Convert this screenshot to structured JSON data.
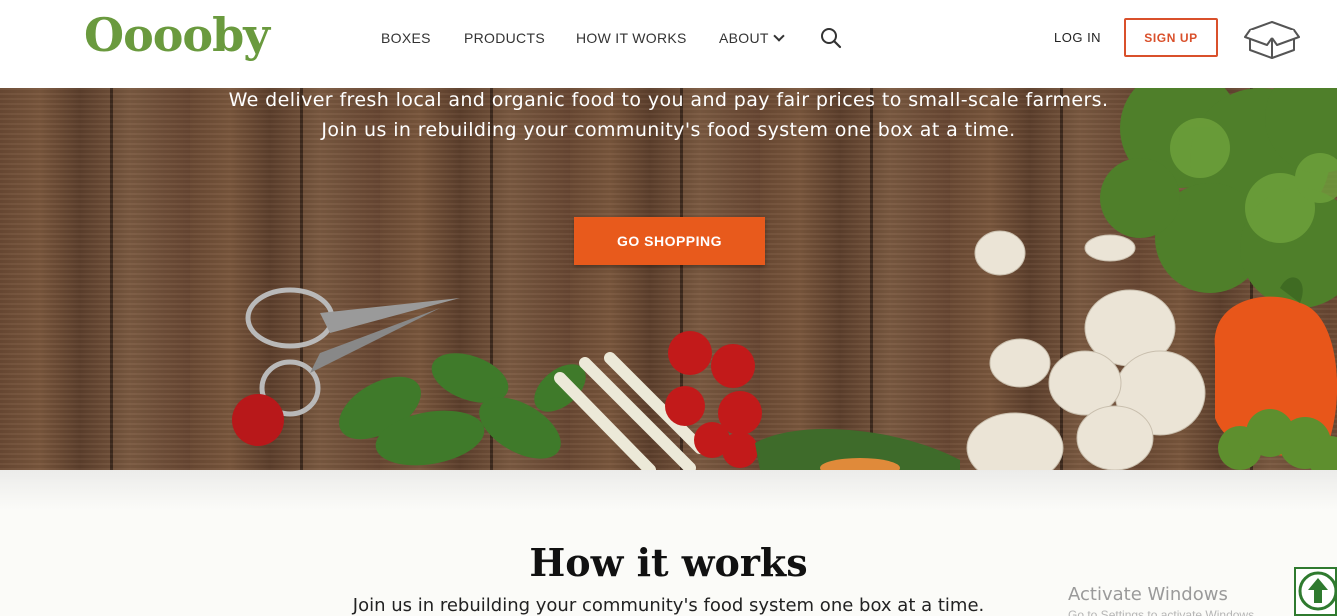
{
  "header": {
    "logo": "Ooooby",
    "nav": [
      "BOXES",
      "PRODUCTS",
      "HOW IT WORKS",
      "ABOUT"
    ],
    "login_label": "LOG IN",
    "signup_label": "SIGN UP"
  },
  "hero": {
    "line1": "We deliver fresh local and organic food to you and pay fair prices to small-scale farmers.",
    "line2": "Join us in rebuilding your community's food system one box at a time.",
    "cta_label": "GO SHOPPING"
  },
  "how": {
    "title": "How it works",
    "subtitle": "Join us in rebuilding your community's food system one box at a time."
  },
  "watermark": {
    "title": "Activate Windows",
    "subtitle": "Go to Settings to activate Windows."
  },
  "colors": {
    "brand_green": "#6a9a3e",
    "accent_orange": "#e85a1c",
    "signup_red": "#d9502b"
  },
  "icons": [
    "search-icon",
    "chevron-down-icon",
    "box-icon",
    "arrow-up-icon"
  ]
}
